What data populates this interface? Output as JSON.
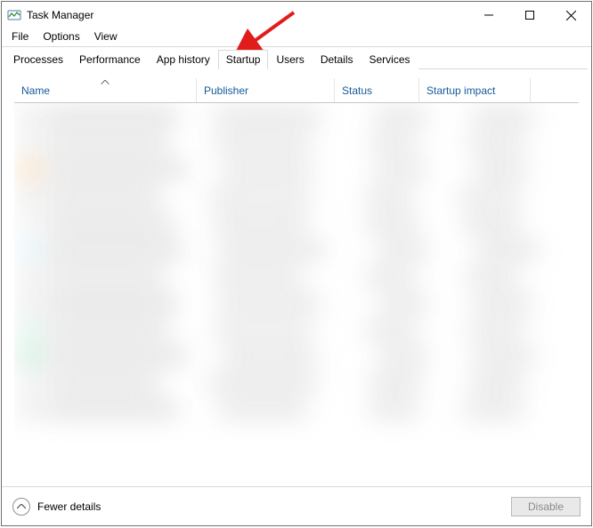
{
  "window": {
    "title": "Task Manager"
  },
  "menu": {
    "file": "File",
    "options": "Options",
    "view": "View"
  },
  "tabs": {
    "processes": "Processes",
    "performance": "Performance",
    "app_history": "App history",
    "startup": "Startup",
    "users": "Users",
    "details": "Details",
    "services": "Services",
    "active": "startup"
  },
  "columns": {
    "name": "Name",
    "publisher": "Publisher",
    "status": "Status",
    "startup_impact": "Startup impact"
  },
  "footer": {
    "fewer_details": "Fewer details",
    "disable": "Disable"
  }
}
